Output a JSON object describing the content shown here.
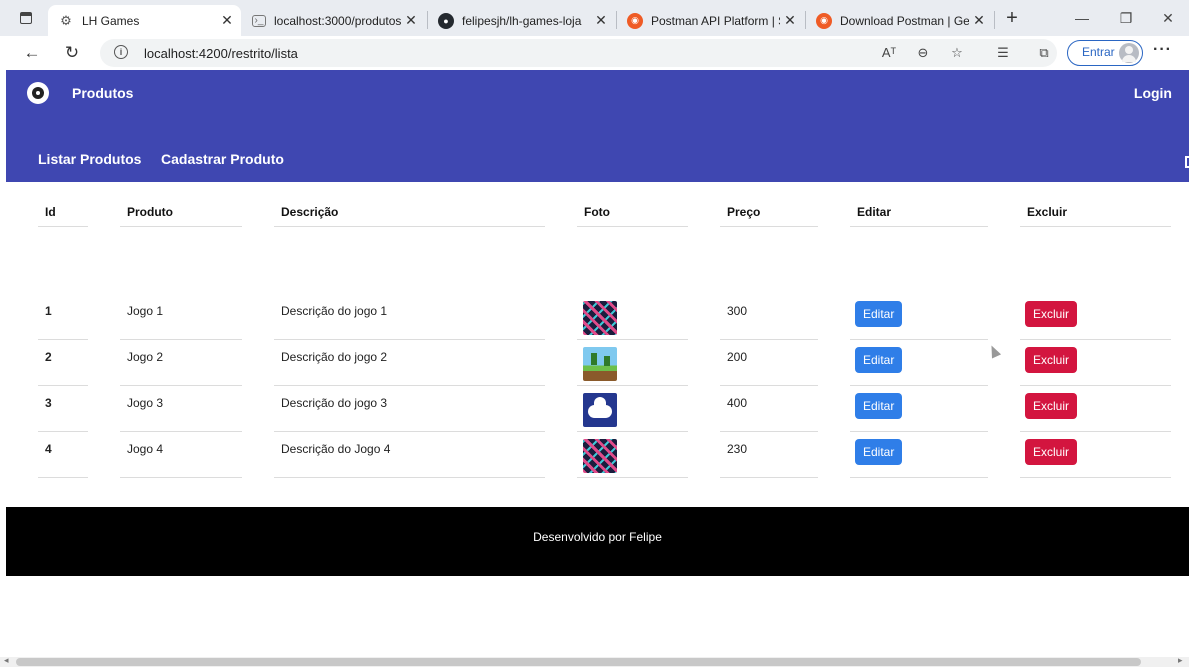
{
  "browser": {
    "tabs": [
      {
        "title": "LH Games",
        "icon": "gear-favicon",
        "active": true
      },
      {
        "title": "localhost:3000/produtos",
        "icon": "terminal-favicon",
        "active": false
      },
      {
        "title": "felipesjh/lh-games-loja",
        "icon": "github-favicon",
        "active": false
      },
      {
        "title": "Postman API Platform | Si",
        "icon": "postman-favicon",
        "active": false
      },
      {
        "title": "Download Postman | Get S",
        "icon": "postman-favicon",
        "active": false
      }
    ],
    "url": "localhost:4200/restrito/lista",
    "read_aloud": "Aᵀ",
    "signin_label": "Entrar",
    "more_label": "···"
  },
  "app": {
    "brand_title": "Produtos",
    "login_label": "Login",
    "nav": [
      "Listar Produtos",
      "Cadastrar Produto"
    ]
  },
  "table": {
    "headers": [
      "Id",
      "Produto",
      "Descrição",
      "Foto",
      "Preço",
      "Editar",
      "Excluir"
    ],
    "rows": [
      {
        "id": "1",
        "produto": "Jogo 1",
        "descricao": "Descrição do jogo 1",
        "foto": "pattern-image",
        "preco": "300"
      },
      {
        "id": "2",
        "produto": "Jogo 2",
        "descricao": "Descrição do jogo 2",
        "foto": "platform-image",
        "preco": "200"
      },
      {
        "id": "3",
        "produto": "Jogo 3",
        "descricao": "Descrição do jogo 3",
        "foto": "controller-image",
        "preco": "400"
      },
      {
        "id": "4",
        "produto": "Jogo 4",
        "descricao": "Descrição do Jogo 4",
        "foto": "pattern-image",
        "preco": "230"
      }
    ],
    "edit_label": "Editar",
    "delete_label": "Excluir"
  },
  "footer": {
    "text": "Desenvolvido por Felipe"
  },
  "colors": {
    "toolbar": "#3f47b1",
    "edit": "#2f7ee8",
    "delete": "#d3153f",
    "footer": "#000000"
  }
}
